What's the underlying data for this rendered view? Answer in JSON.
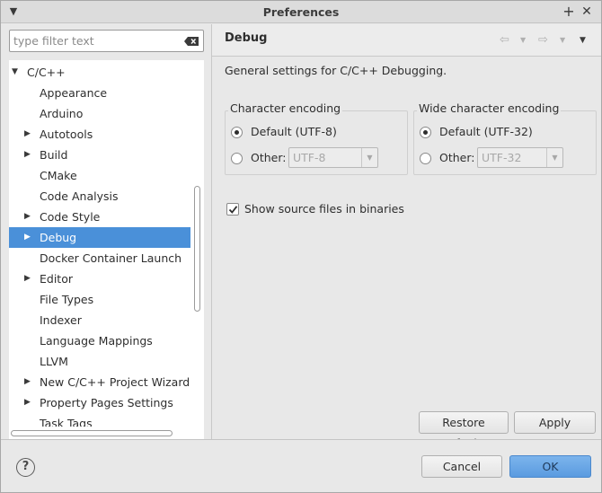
{
  "window": {
    "title": "Preferences"
  },
  "filter": {
    "placeholder": "type filter text",
    "value": ""
  },
  "tree": {
    "root": {
      "label": "C/C++",
      "expanded": true
    },
    "items": [
      {
        "label": "Appearance",
        "has_children": false
      },
      {
        "label": "Arduino",
        "has_children": false
      },
      {
        "label": "Autotools",
        "has_children": true
      },
      {
        "label": "Build",
        "has_children": true
      },
      {
        "label": "CMake",
        "has_children": false
      },
      {
        "label": "Code Analysis",
        "has_children": false
      },
      {
        "label": "Code Style",
        "has_children": true
      },
      {
        "label": "Debug",
        "has_children": true,
        "selected": true
      },
      {
        "label": "Docker Container Launch",
        "has_children": false
      },
      {
        "label": "Editor",
        "has_children": true
      },
      {
        "label": "File Types",
        "has_children": false
      },
      {
        "label": "Indexer",
        "has_children": false
      },
      {
        "label": "Language Mappings",
        "has_children": false
      },
      {
        "label": "LLVM",
        "has_children": false
      },
      {
        "label": "New C/C++ Project Wizard",
        "has_children": true
      },
      {
        "label": "Property Pages Settings",
        "has_children": true
      },
      {
        "label": "Task Tags",
        "has_children": false
      }
    ]
  },
  "page": {
    "title": "Debug",
    "description": "General settings for C/C++ Debugging."
  },
  "char_encoding": {
    "label": "Character encoding",
    "default_label": "Default (UTF-8)",
    "other_label": "Other:",
    "other_value": "UTF-8",
    "selected": "default"
  },
  "wide_encoding": {
    "label": "Wide character encoding",
    "default_label": "Default (UTF-32)",
    "other_label": "Other:",
    "other_value": "UTF-32",
    "selected": "default"
  },
  "show_source": {
    "label": "Show source files in binaries",
    "checked": true
  },
  "buttons": {
    "restore_defaults": "Restore Defaults",
    "apply": "Apply",
    "cancel": "Cancel",
    "ok": "OK"
  },
  "help": {
    "glyph": "?"
  },
  "colors": {
    "selection": "#4a90d9",
    "primary_button": "#6aa8e6"
  }
}
